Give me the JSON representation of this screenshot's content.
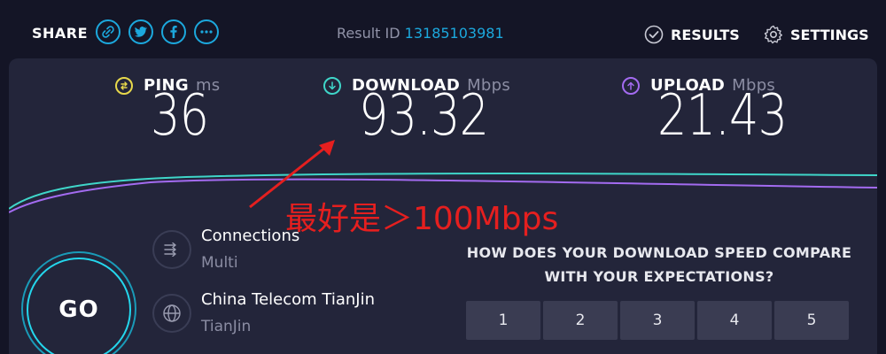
{
  "header": {
    "share_label": "SHARE",
    "share_icons": [
      "link-icon",
      "twitter-icon",
      "facebook-icon",
      "more-icon"
    ],
    "result_id_label": "Result ID",
    "result_id_value": "13185103981",
    "results_label": "RESULTS",
    "settings_label": "SETTINGS"
  },
  "metrics": {
    "ping": {
      "label": "PING",
      "unit": "ms",
      "value": "36",
      "color": "#e7d84b"
    },
    "download": {
      "label": "DOWNLOAD",
      "unit": "Mbps",
      "value": "93.32",
      "color": "#3fd6c9"
    },
    "upload": {
      "label": "UPLOAD",
      "unit": "Mbps",
      "value": "21.43",
      "color": "#a36bf0"
    }
  },
  "annotation": {
    "text": "最好是＞100Mbps",
    "color": "#e51f1f"
  },
  "go_button": {
    "label": "GO"
  },
  "connection": {
    "connections_title": "Connections",
    "connections_value": "Multi",
    "server_title": "China Telecom TianJin",
    "server_location": "TianJin"
  },
  "survey": {
    "question": "HOW DOES YOUR DOWNLOAD SPEED COMPARE WITH YOUR EXPECTATIONS?",
    "options": [
      "1",
      "2",
      "3",
      "4",
      "5"
    ]
  },
  "colors": {
    "background": "#141526",
    "panel": "#23253a",
    "accent_blue": "#1ca8dd"
  }
}
